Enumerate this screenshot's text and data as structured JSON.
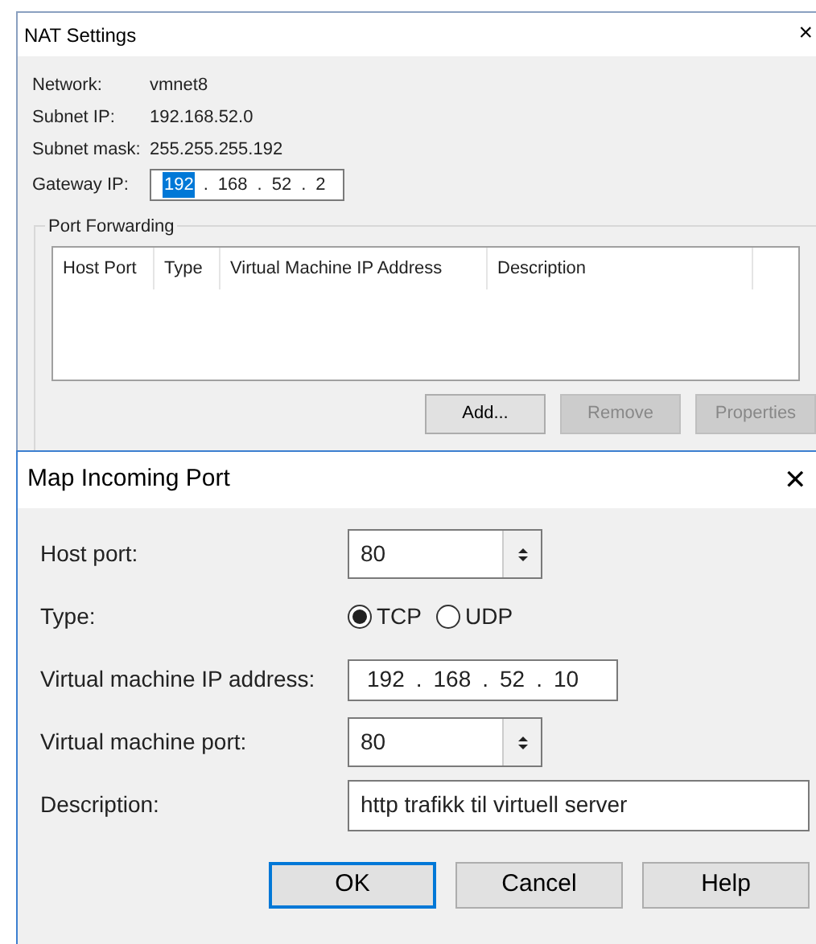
{
  "nat_window": {
    "title": "NAT Settings",
    "close": "×",
    "info": [
      {
        "label": "Network:",
        "value": "vmnet8"
      },
      {
        "label": "Subnet IP:",
        "value": "192.168.52.0"
      },
      {
        "label": "Subnet mask:",
        "value": "255.255.255.192"
      }
    ],
    "gateway": {
      "label": "Gateway IP:",
      "separator": ".",
      "octets": [
        {
          "text": "192",
          "selected": true
        },
        {
          "text": "168",
          "selected": false
        },
        {
          "text": "52",
          "selected": false
        },
        {
          "text": "2",
          "selected": false
        }
      ]
    },
    "port_forwarding": {
      "title": "Port Forwarding",
      "columns": [
        "Host Port",
        "Type",
        "Virtual Machine IP Address",
        "Description"
      ],
      "buttons": [
        {
          "label": "Add...",
          "disabled": false
        },
        {
          "label": "Remove",
          "disabled": true
        },
        {
          "label": "Properties",
          "disabled": true
        }
      ]
    }
  },
  "dialog": {
    "title": "Map Incoming Port",
    "close": "✕",
    "fields": [
      {
        "kind": "spin",
        "label": "Host port:",
        "value": "80"
      },
      {
        "kind": "radio",
        "label": "Type:",
        "options": [
          {
            "label": "TCP",
            "selected": true
          },
          {
            "label": "UDP",
            "selected": false
          }
        ]
      },
      {
        "kind": "ip",
        "label": "Virtual machine IP address:",
        "separator": ".",
        "octets": [
          "192",
          "168",
          "52",
          "10"
        ]
      },
      {
        "kind": "spin",
        "label": "Virtual machine port:",
        "value": "80"
      },
      {
        "kind": "text",
        "label": "Description:",
        "value": "http trafikk til virtuell server"
      }
    ],
    "buttons": [
      {
        "label": "OK",
        "default": true
      },
      {
        "label": "Cancel",
        "default": false
      },
      {
        "label": "Help",
        "default": false
      }
    ]
  }
}
